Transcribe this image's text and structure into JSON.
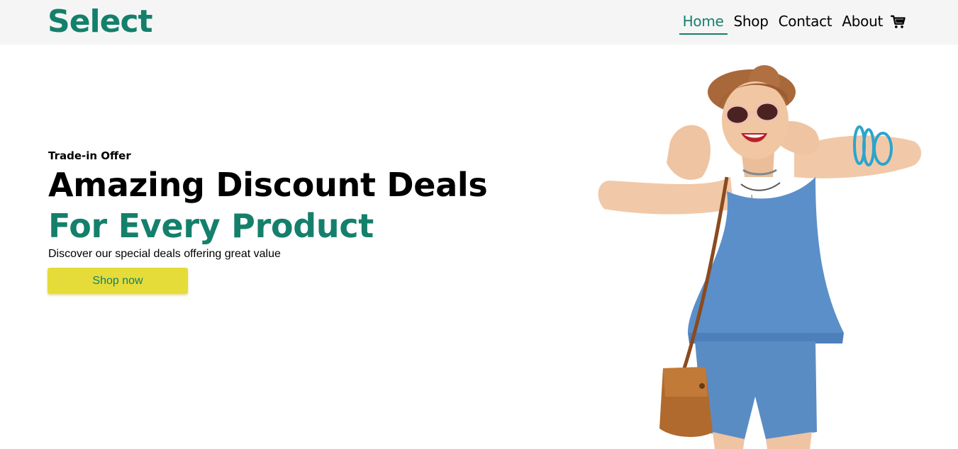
{
  "brand": {
    "logo_text": "Select",
    "accent_color": "#14806b",
    "cta_color": "#e5dc3a"
  },
  "nav": {
    "items": [
      {
        "label": "Home",
        "active": true
      },
      {
        "label": "Shop",
        "active": false
      },
      {
        "label": "Contact",
        "active": false
      },
      {
        "label": "About",
        "active": false
      }
    ],
    "cart_icon": "cart-icon"
  },
  "hero": {
    "eyebrow": "Trade-in Offer",
    "headline_line1": "Amazing Discount Deals",
    "headline_line2": "For Every Product",
    "subtext": "Discover our special deals offering great value",
    "cta_label": "Shop now"
  }
}
